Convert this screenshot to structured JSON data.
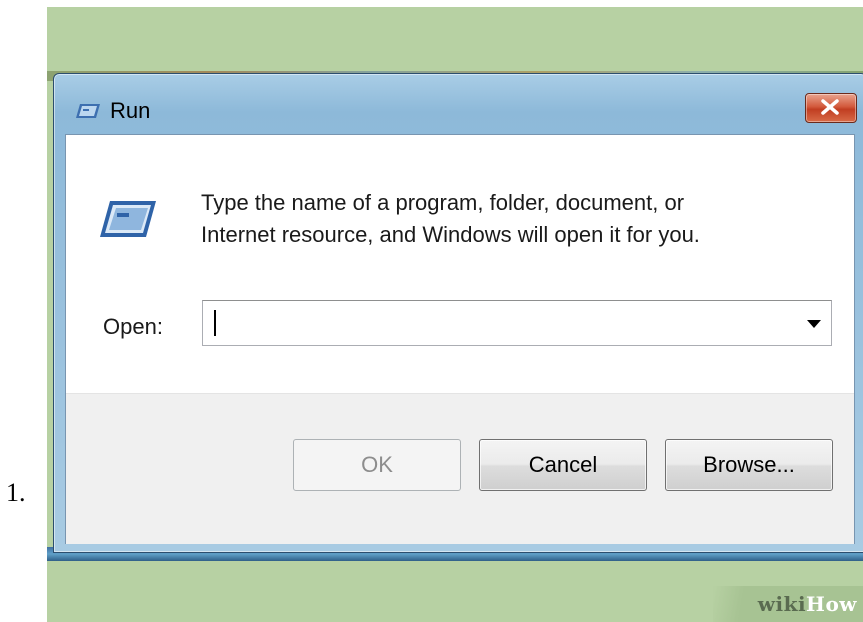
{
  "list": {
    "number": "1."
  },
  "dialog": {
    "title": "Run",
    "description_line1": "Type the name of a program, folder, document, or",
    "description_line2": "Internet resource, and Windows will open it for you.",
    "open_label": "Open:",
    "open_value": "",
    "buttons": {
      "ok": "OK",
      "cancel": "Cancel",
      "browse": "Browse..."
    }
  },
  "watermark": {
    "wiki": "wiki",
    "how": "How"
  },
  "colors": {
    "background_green": "#b7d1a3",
    "titlebar_blue": "#8db9d9",
    "close_red": "#c13e22",
    "button_area": "#f0f0f0"
  },
  "icons": [
    "run-title-icon",
    "close-icon",
    "run-program-icon",
    "dropdown-arrow-icon"
  ]
}
